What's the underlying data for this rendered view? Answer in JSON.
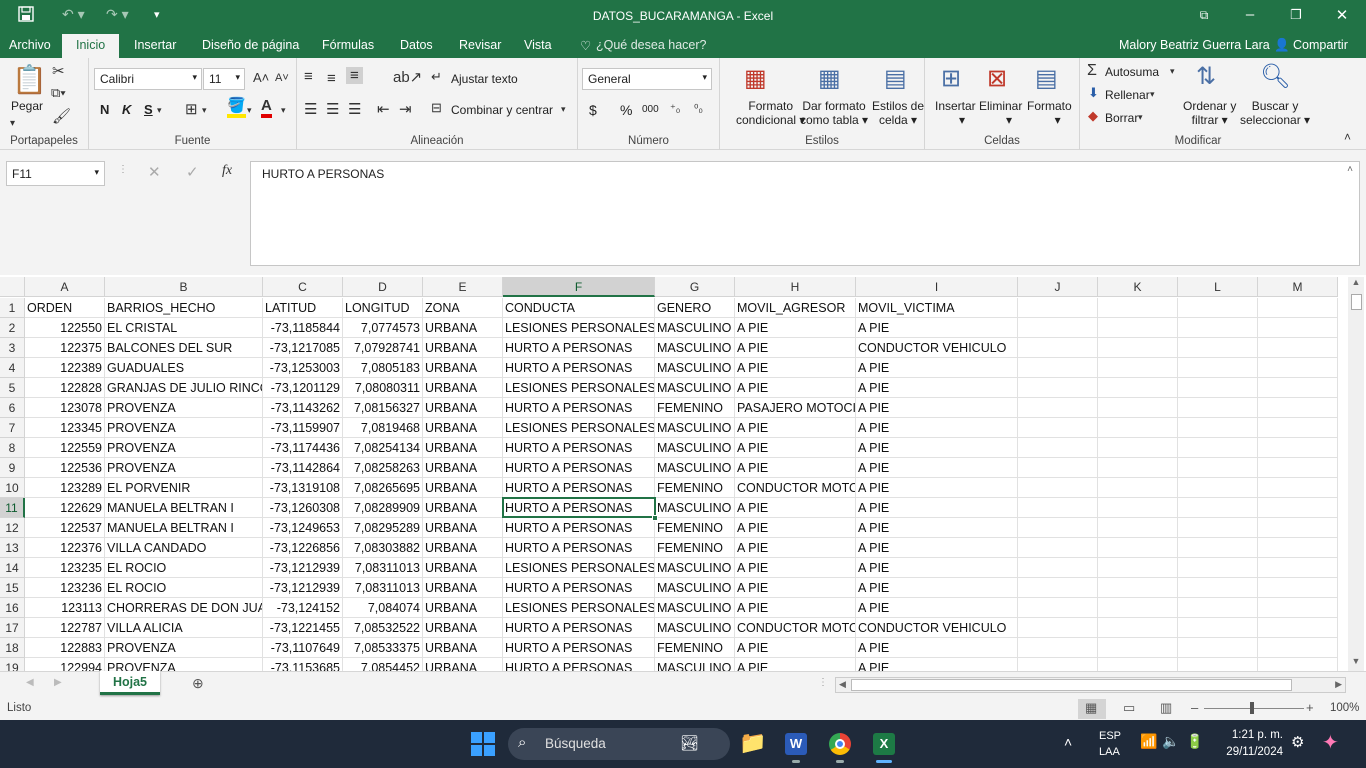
{
  "window": {
    "title": "DATOS_BUCARAMANGA - Excel"
  },
  "menu": {
    "tabs": [
      "Archivo",
      "Inicio",
      "Insertar",
      "Diseño de página",
      "Fórmulas",
      "Datos",
      "Revisar",
      "Vista"
    ],
    "tell_me": "¿Qué desea hacer?",
    "user": "Malory Beatriz Guerra Lara",
    "share": "Compartir"
  },
  "ribbon": {
    "clipboard": {
      "paste": "Pegar",
      "label": "Portapapeles"
    },
    "font": {
      "name": "Calibri",
      "size": "11",
      "bold": "N",
      "italic": "K",
      "underline": "S",
      "label": "Fuente"
    },
    "alignment": {
      "wrap": "Ajustar texto",
      "merge": "Combinar y centrar",
      "label": "Alineación"
    },
    "number": {
      "format": "General",
      "currency": "$",
      "percent": "%",
      "thousands": "000",
      "label": "Número"
    },
    "styles": {
      "conditional": "Formato",
      "conditional2": "condicional",
      "table": "Dar formato",
      "table2": "como tabla",
      "cell": "Estilos de",
      "cell2": "celda",
      "label": "Estilos"
    },
    "cells": {
      "insert": "Insertar",
      "delete": "Eliminar",
      "format": "Formato",
      "label": "Celdas"
    },
    "editing": {
      "autosum": "Autosuma",
      "fill": "Rellenar",
      "clear": "Borrar",
      "sort": "Ordenar y",
      "sort2": "filtrar",
      "find": "Buscar y",
      "find2": "seleccionar",
      "label": "Modificar"
    }
  },
  "formula_bar": {
    "name_box": "F11",
    "fx": "fx",
    "content": "HURTO A PERSONAS"
  },
  "grid": {
    "columns": [
      "A",
      "B",
      "C",
      "D",
      "E",
      "F",
      "G",
      "H",
      "I",
      "J",
      "K",
      "L",
      "M"
    ],
    "rows": [
      [
        "ORDEN",
        "BARRIOS_HECHO",
        "LATITUD",
        "LONGITUD",
        "ZONA",
        "CONDUCTA",
        "GENERO",
        "MOVIL_AGRESOR",
        "MOVIL_VICTIMA"
      ],
      [
        "122550",
        "EL CRISTAL",
        "-73,1185844",
        "7,0774573",
        "URBANA",
        "LESIONES PERSONALES",
        "MASCULINO",
        "A PIE",
        "A PIE"
      ],
      [
        "122375",
        "BALCONES DEL SUR",
        "-73,1217085",
        "7,07928741",
        "URBANA",
        "HURTO A PERSONAS",
        "MASCULINO",
        "A PIE",
        "CONDUCTOR VEHICULO"
      ],
      [
        "122389",
        "GUADUALES",
        "-73,1253003",
        "7,0805183",
        "URBANA",
        "HURTO A PERSONAS",
        "MASCULINO",
        "A PIE",
        "A PIE"
      ],
      [
        "122828",
        "GRANJAS DE JULIO RINCON",
        "-73,1201129",
        "7,08080311",
        "URBANA",
        "LESIONES PERSONALES",
        "MASCULINO",
        "A PIE",
        "A PIE"
      ],
      [
        "123078",
        "PROVENZA",
        "-73,1143262",
        "7,08156327",
        "URBANA",
        "HURTO A PERSONAS",
        "FEMENINO",
        "PASAJERO MOTOCICLETA",
        "A PIE"
      ],
      [
        "123345",
        "PROVENZA",
        "-73,1159907",
        "7,0819468",
        "URBANA",
        "LESIONES PERSONALES",
        "MASCULINO",
        "A PIE",
        "A PIE"
      ],
      [
        "122559",
        "PROVENZA",
        "-73,1174436",
        "7,08254134",
        "URBANA",
        "HURTO A PERSONAS",
        "MASCULINO",
        "A PIE",
        "A PIE"
      ],
      [
        "122536",
        "PROVENZA",
        "-73,1142864",
        "7,08258263",
        "URBANA",
        "HURTO A PERSONAS",
        "MASCULINO",
        "A PIE",
        "A PIE"
      ],
      [
        "123289",
        "EL PORVENIR",
        "-73,1319108",
        "7,08265695",
        "URBANA",
        "HURTO A PERSONAS",
        "FEMENINO",
        "CONDUCTOR MOTOCICLETA",
        "A PIE"
      ],
      [
        "122629",
        "MANUELA BELTRAN I",
        "-73,1260308",
        "7,08289909",
        "URBANA",
        "HURTO A PERSONAS",
        "MASCULINO",
        "A PIE",
        "A PIE"
      ],
      [
        "122537",
        "MANUELA BELTRAN I",
        "-73,1249653",
        "7,08295289",
        "URBANA",
        "HURTO A PERSONAS",
        "FEMENINO",
        "A PIE",
        "A PIE"
      ],
      [
        "122376",
        "VILLA CANDADO",
        "-73,1226856",
        "7,08303882",
        "URBANA",
        "HURTO A PERSONAS",
        "FEMENINO",
        "A PIE",
        "A PIE"
      ],
      [
        "123235",
        "EL ROCIO",
        "-73,1212939",
        "7,08311013",
        "URBANA",
        "LESIONES PERSONALES",
        "MASCULINO",
        "A PIE",
        "A PIE"
      ],
      [
        "123236",
        "EL ROCIO",
        "-73,1212939",
        "7,08311013",
        "URBANA",
        "HURTO A PERSONAS",
        "MASCULINO",
        "A PIE",
        "A PIE"
      ],
      [
        "123113",
        "CHORRERAS DE DON JUAN",
        "-73,124152",
        "7,084074",
        "URBANA",
        "LESIONES PERSONALES",
        "MASCULINO",
        "A PIE",
        "A PIE"
      ],
      [
        "122787",
        "VILLA ALICIA",
        "-73,1221455",
        "7,08532522",
        "URBANA",
        "HURTO A PERSONAS",
        "MASCULINO",
        "CONDUCTOR MOTOCICLETA",
        "CONDUCTOR VEHICULO"
      ],
      [
        "122883",
        "PROVENZA",
        "-73,1107649",
        "7,08533375",
        "URBANA",
        "HURTO A PERSONAS",
        "FEMENINO",
        "A PIE",
        "A PIE"
      ],
      [
        "122994",
        "PROVENZA",
        "-73,1153685",
        "7,0854452",
        "URBANA",
        "HURTO A PERSONAS",
        "MASCULINO",
        "A PIE",
        "A PIE"
      ]
    ]
  },
  "sheet_tabs": {
    "active": "Hoja5"
  },
  "status": {
    "text": "Listo",
    "zoom": "100%"
  },
  "taskbar": {
    "search": "Búsqueda",
    "lang1": "ESP",
    "lang2": "LAA",
    "time": "1:21 p. m.",
    "date": "29/11/2024"
  },
  "colors": {
    "excel_green": "#217346",
    "taskbar": "#1f2a3a"
  }
}
